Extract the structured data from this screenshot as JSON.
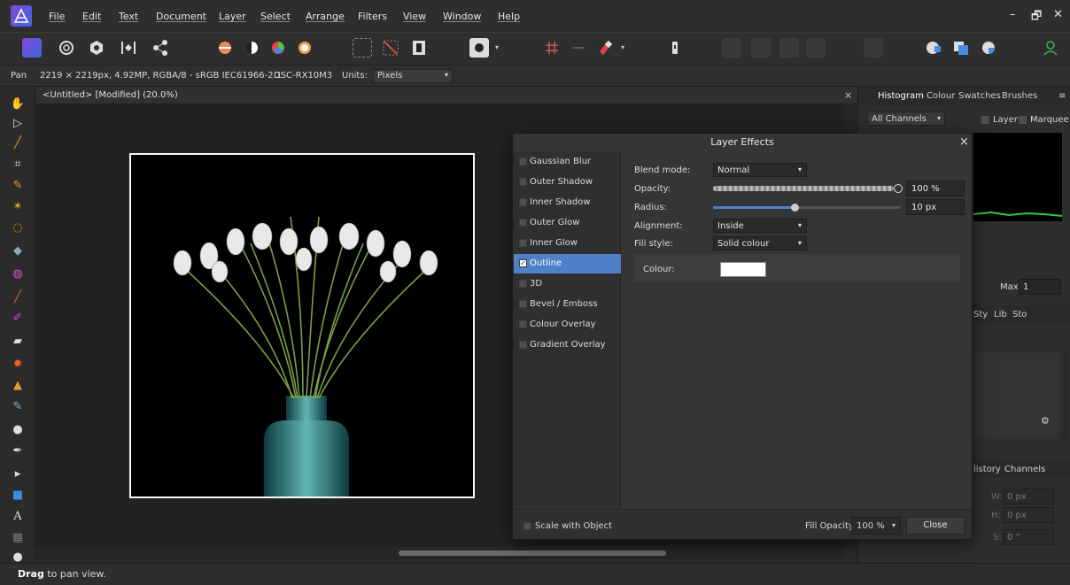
{
  "menu": {
    "items": [
      "File",
      "Edit",
      "Text",
      "Document",
      "Layer",
      "Select",
      "Arrange",
      "Filters",
      "View",
      "Window",
      "Help"
    ]
  },
  "window_controls": {
    "minimize": "–",
    "restore": "🗗",
    "close": "✕"
  },
  "context_bar": {
    "tool_name": "Pan",
    "image_info": "2219 × 2219px, 4.92MP, RGBA/8 - sRGB IEC61966-2.1",
    "camera": "DSC-RX10M3",
    "units_label": "Units:",
    "units_value": "Pixels"
  },
  "document": {
    "tab_label": "<Untitled> [Modified] (20.0%)",
    "close": "×"
  },
  "right_panel": {
    "tabs": [
      "Histogram",
      "Colour",
      "Swatches",
      "Brushes"
    ],
    "channels_select": "All Channels",
    "layer_label": "Layer",
    "marquee_label": "Marquee",
    "max_label": "Max:",
    "max_value": "1",
    "tabs2": [
      "Sty",
      "Lib",
      "Sto"
    ],
    "tabs3": [
      "listory",
      "Channels"
    ],
    "w_label": "W:",
    "w_value": "0 px",
    "h_label": "H:",
    "h_value": "0 px",
    "s_label": "S:",
    "s_value": "0 °"
  },
  "dialog": {
    "title": "Layer Effects",
    "close": "×",
    "effects": [
      {
        "label": "Gaussian Blur",
        "checked": false,
        "selected": false
      },
      {
        "label": "Outer Shadow",
        "checked": false,
        "selected": false
      },
      {
        "label": "Inner Shadow",
        "checked": false,
        "selected": false
      },
      {
        "label": "Outer Glow",
        "checked": false,
        "selected": false
      },
      {
        "label": "Inner Glow",
        "checked": false,
        "selected": false
      },
      {
        "label": "Outline",
        "checked": true,
        "selected": true
      },
      {
        "label": "3D",
        "checked": false,
        "selected": false
      },
      {
        "label": "Bevel / Emboss",
        "checked": false,
        "selected": false
      },
      {
        "label": "Colour Overlay",
        "checked": false,
        "selected": false
      },
      {
        "label": "Gradient Overlay",
        "checked": false,
        "selected": false
      }
    ],
    "settings": {
      "blend_mode_label": "Blend mode:",
      "blend_mode_value": "Normal",
      "opacity_label": "Opacity:",
      "opacity_value": "100 %",
      "opacity_fraction": 1.0,
      "radius_label": "Radius:",
      "radius_value": "10 px",
      "alignment_label": "Alignment:",
      "alignment_value": "Inside",
      "fill_style_label": "Fill style:",
      "fill_style_value": "Solid colour",
      "colour_label": "Colour:",
      "colour_value": "#ffffff"
    },
    "footer": {
      "scale_label": "Scale with Object",
      "fill_opacity_label": "Fill Opacity:",
      "fill_opacity_value": "100 %",
      "close_button": "Close"
    }
  },
  "status": {
    "bold": "Drag",
    "text": " to pan view."
  },
  "colors": {
    "accent": "#4f80c8",
    "panel": "#353535",
    "canvas": "#222222"
  }
}
